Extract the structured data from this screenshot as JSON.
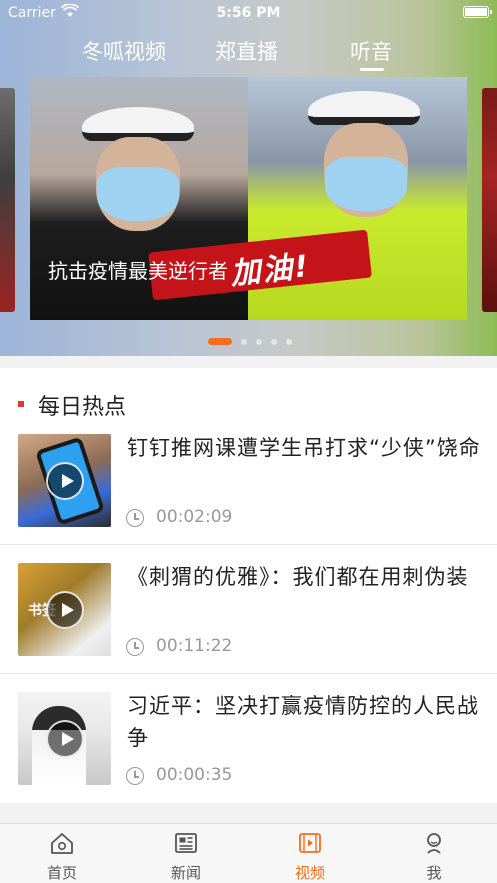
{
  "status_bar": {
    "carrier": "Carrier",
    "time": "5:56 PM"
  },
  "top_tabs": [
    {
      "label": "冬呱视频"
    },
    {
      "label": "郑直播"
    },
    {
      "label": "听音",
      "selected": true
    }
  ],
  "banner": {
    "caption": "抗击疫情最美逆行者",
    "overlay_text": "加油!",
    "page_count": 5,
    "active_page": 1
  },
  "section": {
    "title": "每日热点"
  },
  "news": [
    {
      "title": "钉钉推网课遭学生吊打求“少侠”饶命",
      "duration": "00:02:09",
      "thumb_icon": "play-icon"
    },
    {
      "title": "《刺猬的优雅》：我们都在用刺伪装",
      "duration": "00:11:22",
      "thumb_icon": "play-icon",
      "thumb_text": "书签"
    },
    {
      "title": "习近平：坚决打赢疫情防控的人民战争",
      "duration": "00:00:35",
      "thumb_icon": "play-icon"
    }
  ],
  "tabbar": [
    {
      "label": "首页",
      "icon": "home-icon"
    },
    {
      "label": "新闻",
      "icon": "news-icon"
    },
    {
      "label": "视频",
      "icon": "video-icon",
      "selected": true
    },
    {
      "label": "我",
      "icon": "profile-icon"
    }
  ],
  "colors": {
    "accent": "#f36e21",
    "section_marker": "#e0382c"
  }
}
